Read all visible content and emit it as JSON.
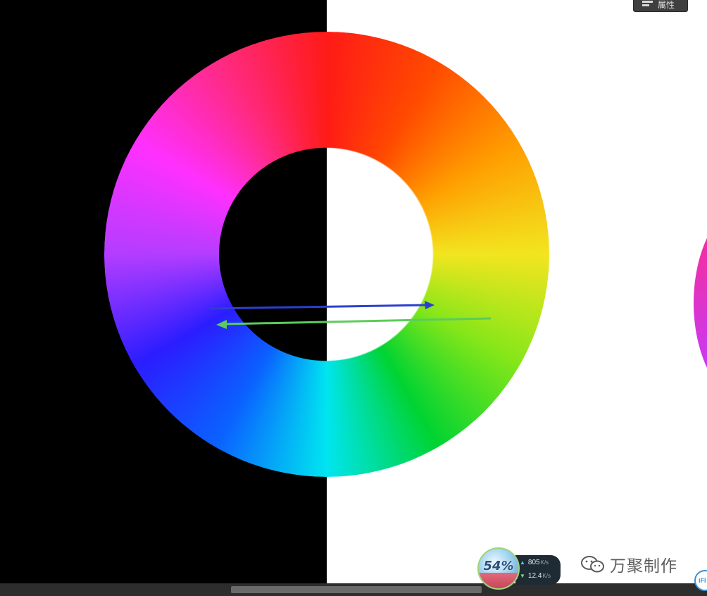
{
  "panel_button": {
    "label": "属性",
    "icon": "properties-panel-icon"
  },
  "color_wheel": {
    "hue_stops": [
      "#ff1b17",
      "#ff4a00",
      "#ff9d00",
      "#f2e51f",
      "#84e619",
      "#00d332",
      "#00e5f0",
      "#0a62ff",
      "#2b1dff",
      "#b33dff",
      "#ff30ff",
      "#ff2a86"
    ],
    "background_left": "#000000",
    "background_right": "#ffffff"
  },
  "annotations": {
    "blue_arrow_color": "#2c3fd0",
    "green_arrow_color": "#5bcc5b"
  },
  "speed_widget": {
    "percent": "54%",
    "upload": "805",
    "upload_unit": "K/s",
    "download": "12.4",
    "download_unit": "K/s"
  },
  "watermark": {
    "text": "万聚制作",
    "icon": "wechat-icon"
  },
  "corner_badge": {
    "text": "iFl"
  }
}
